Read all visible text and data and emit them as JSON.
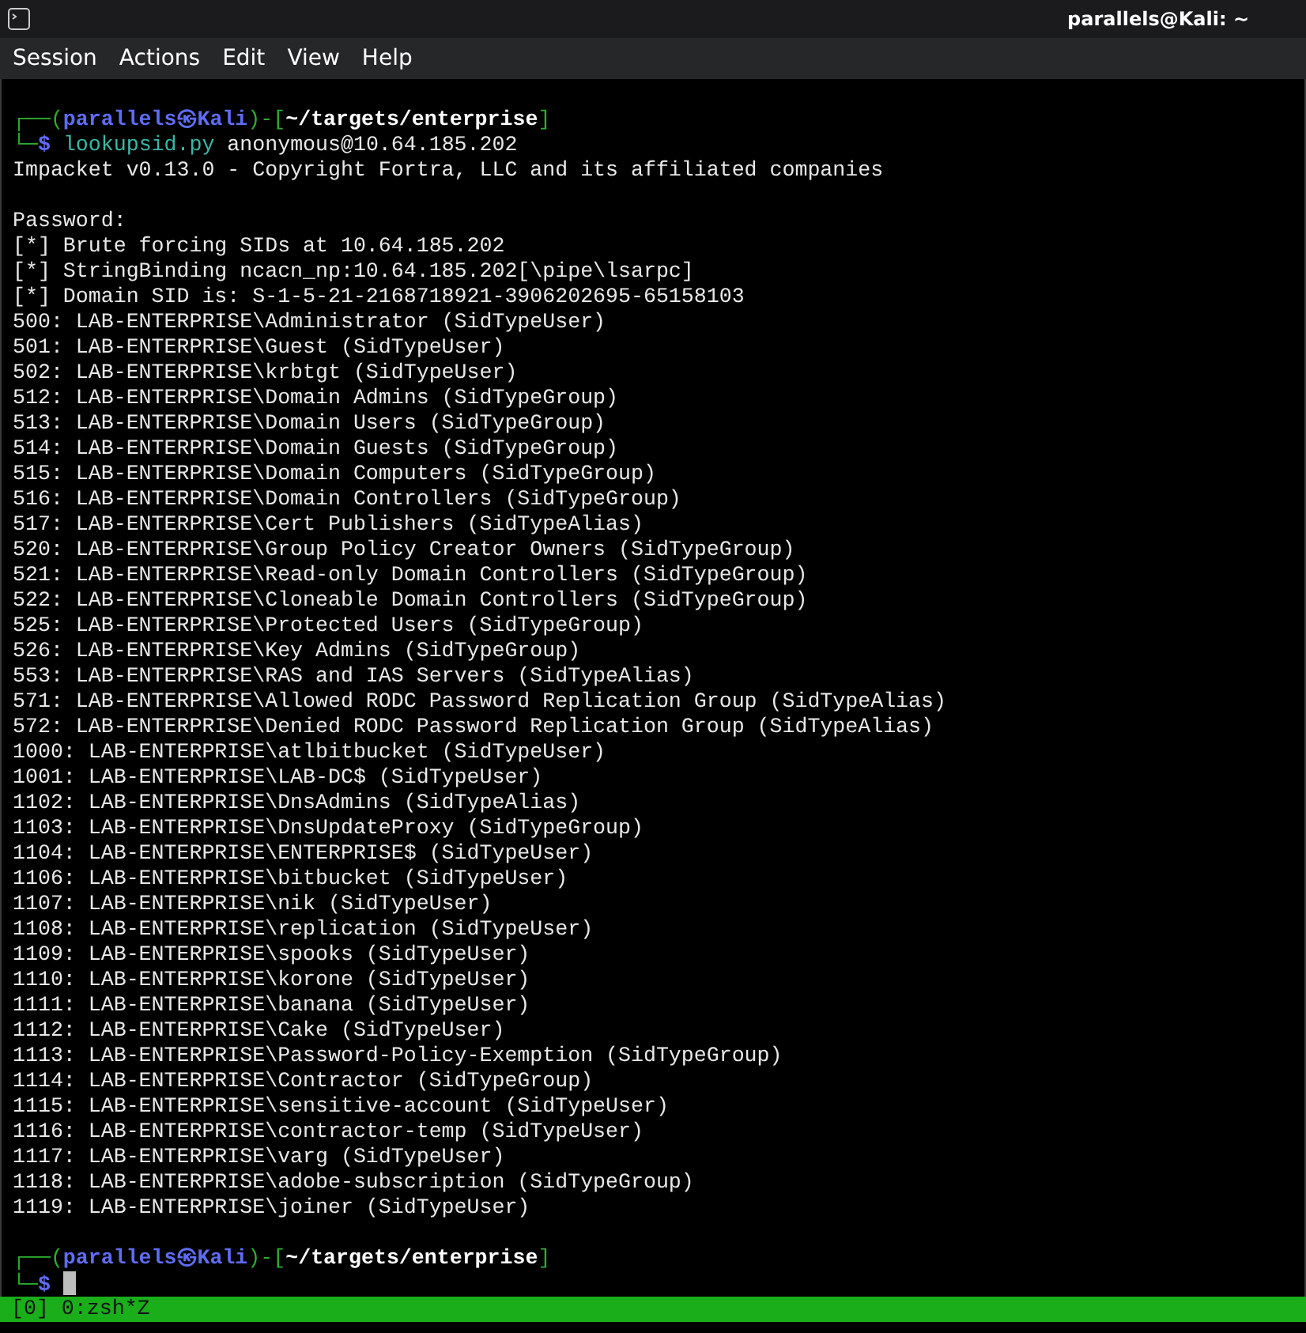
{
  "window": {
    "title": "parallels@Kali: ~"
  },
  "menu": [
    "Session",
    "Actions",
    "Edit",
    "View",
    "Help"
  ],
  "lines": [
    {
      "kind": "prompt",
      "open": "┌──(",
      "user": "parallels",
      "symbol": "㉿",
      "host": "Kali",
      "mid": ")-[",
      "path": "~/targets/enterprise",
      "close": "]"
    },
    {
      "kind": "command",
      "corner": "└─",
      "sign": "$",
      "program": "lookupsid.py",
      "args": "anonymous@10.64.185.202"
    },
    {
      "kind": "output",
      "text": "Impacket v0.13.0 - Copyright Fortra, LLC and its affiliated companies"
    },
    {
      "kind": "blank"
    },
    {
      "kind": "output",
      "text": "Password:"
    },
    {
      "kind": "output",
      "text": "[*] Brute forcing SIDs at 10.64.185.202"
    },
    {
      "kind": "output",
      "text": "[*] StringBinding ncacn_np:10.64.185.202[\\pipe\\lsarpc]"
    },
    {
      "kind": "output",
      "text": "[*] Domain SID is: S-1-5-21-2168718921-3906202695-65158103"
    },
    {
      "kind": "output",
      "text": "500: LAB-ENTERPRISE\\Administrator (SidTypeUser)"
    },
    {
      "kind": "output",
      "text": "501: LAB-ENTERPRISE\\Guest (SidTypeUser)"
    },
    {
      "kind": "output",
      "text": "502: LAB-ENTERPRISE\\krbtgt (SidTypeUser)"
    },
    {
      "kind": "output",
      "text": "512: LAB-ENTERPRISE\\Domain Admins (SidTypeGroup)"
    },
    {
      "kind": "output",
      "text": "513: LAB-ENTERPRISE\\Domain Users (SidTypeGroup)"
    },
    {
      "kind": "output",
      "text": "514: LAB-ENTERPRISE\\Domain Guests (SidTypeGroup)"
    },
    {
      "kind": "output",
      "text": "515: LAB-ENTERPRISE\\Domain Computers (SidTypeGroup)"
    },
    {
      "kind": "output",
      "text": "516: LAB-ENTERPRISE\\Domain Controllers (SidTypeGroup)"
    },
    {
      "kind": "output",
      "text": "517: LAB-ENTERPRISE\\Cert Publishers (SidTypeAlias)"
    },
    {
      "kind": "output",
      "text": "520: LAB-ENTERPRISE\\Group Policy Creator Owners (SidTypeGroup)"
    },
    {
      "kind": "output",
      "text": "521: LAB-ENTERPRISE\\Read-only Domain Controllers (SidTypeGroup)"
    },
    {
      "kind": "output",
      "text": "522: LAB-ENTERPRISE\\Cloneable Domain Controllers (SidTypeGroup)"
    },
    {
      "kind": "output",
      "text": "525: LAB-ENTERPRISE\\Protected Users (SidTypeGroup)"
    },
    {
      "kind": "output",
      "text": "526: LAB-ENTERPRISE\\Key Admins (SidTypeGroup)"
    },
    {
      "kind": "output",
      "text": "553: LAB-ENTERPRISE\\RAS and IAS Servers (SidTypeAlias)"
    },
    {
      "kind": "output",
      "text": "571: LAB-ENTERPRISE\\Allowed RODC Password Replication Group (SidTypeAlias)"
    },
    {
      "kind": "output",
      "text": "572: LAB-ENTERPRISE\\Denied RODC Password Replication Group (SidTypeAlias)"
    },
    {
      "kind": "output",
      "text": "1000: LAB-ENTERPRISE\\atlbitbucket (SidTypeUser)"
    },
    {
      "kind": "output",
      "text": "1001: LAB-ENTERPRISE\\LAB-DC$ (SidTypeUser)"
    },
    {
      "kind": "output",
      "text": "1102: LAB-ENTERPRISE\\DnsAdmins (SidTypeAlias)"
    },
    {
      "kind": "output",
      "text": "1103: LAB-ENTERPRISE\\DnsUpdateProxy (SidTypeGroup)"
    },
    {
      "kind": "output",
      "text": "1104: LAB-ENTERPRISE\\ENTERPRISE$ (SidTypeUser)"
    },
    {
      "kind": "output",
      "text": "1106: LAB-ENTERPRISE\\bitbucket (SidTypeUser)"
    },
    {
      "kind": "output",
      "text": "1107: LAB-ENTERPRISE\\nik (SidTypeUser)"
    },
    {
      "kind": "output",
      "text": "1108: LAB-ENTERPRISE\\replication (SidTypeUser)"
    },
    {
      "kind": "output",
      "text": "1109: LAB-ENTERPRISE\\spooks (SidTypeUser)"
    },
    {
      "kind": "output",
      "text": "1110: LAB-ENTERPRISE\\korone (SidTypeUser)"
    },
    {
      "kind": "output",
      "text": "1111: LAB-ENTERPRISE\\banana (SidTypeUser)"
    },
    {
      "kind": "output",
      "text": "1112: LAB-ENTERPRISE\\Cake (SidTypeUser)"
    },
    {
      "kind": "output",
      "text": "1113: LAB-ENTERPRISE\\Password-Policy-Exemption (SidTypeGroup)"
    },
    {
      "kind": "output",
      "text": "1114: LAB-ENTERPRISE\\Contractor (SidTypeGroup)"
    },
    {
      "kind": "output",
      "text": "1115: LAB-ENTERPRISE\\sensitive-account (SidTypeUser)"
    },
    {
      "kind": "output",
      "text": "1116: LAB-ENTERPRISE\\contractor-temp (SidTypeUser)"
    },
    {
      "kind": "output",
      "text": "1117: LAB-ENTERPRISE\\varg (SidTypeUser)"
    },
    {
      "kind": "output",
      "text": "1118: LAB-ENTERPRISE\\adobe-subscription (SidTypeGroup)"
    },
    {
      "kind": "output",
      "text": "1119: LAB-ENTERPRISE\\joiner (SidTypeUser)"
    },
    {
      "kind": "blank"
    },
    {
      "kind": "prompt",
      "open": "┌──(",
      "user": "parallels",
      "symbol": "㉿",
      "host": "Kali",
      "mid": ")-[",
      "path": "~/targets/enterprise",
      "close": "]"
    },
    {
      "kind": "input",
      "corner": "└─",
      "sign": "$"
    }
  ],
  "status_bar": {
    "text": "[0] 0:zsh*Z"
  }
}
